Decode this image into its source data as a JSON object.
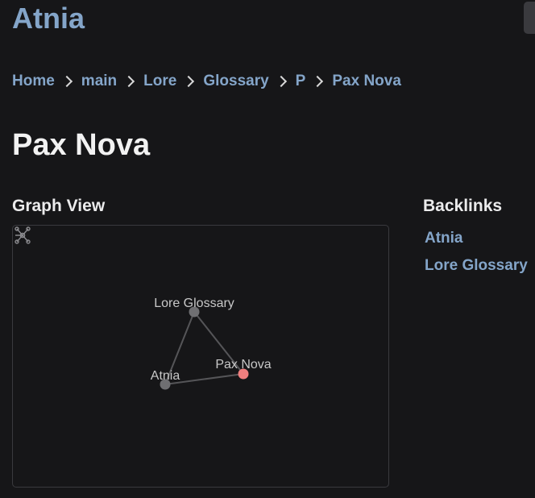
{
  "site": {
    "title": "Atnia"
  },
  "breadcrumb": [
    "Home",
    "main",
    "Lore",
    "Glossary",
    "P",
    "Pax Nova"
  ],
  "article": {
    "title": "Pax Nova"
  },
  "graph": {
    "heading": "Graph View",
    "nodes": [
      {
        "id": "lore-glossary",
        "label": "Lore Glossary",
        "current": false
      },
      {
        "id": "atnia",
        "label": "Atnia",
        "current": false
      },
      {
        "id": "pax-nova",
        "label": "Pax Nova",
        "current": true
      }
    ],
    "edges": [
      [
        "lore-glossary",
        "atnia"
      ],
      [
        "lore-glossary",
        "pax-nova"
      ],
      [
        "atnia",
        "pax-nova"
      ]
    ],
    "colors": {
      "node": "#6f6f72",
      "current_node": "#f07f7f",
      "edge": "#555558"
    }
  },
  "backlinks": {
    "heading": "Backlinks",
    "items": [
      "Atnia",
      "Lore Glossary"
    ]
  },
  "colors": {
    "background": "#161618",
    "accent": "#84a5c9",
    "text": "#ebebec"
  },
  "icons": {
    "graph": "global-graph-icon",
    "separator": "chevron-right-icon"
  }
}
